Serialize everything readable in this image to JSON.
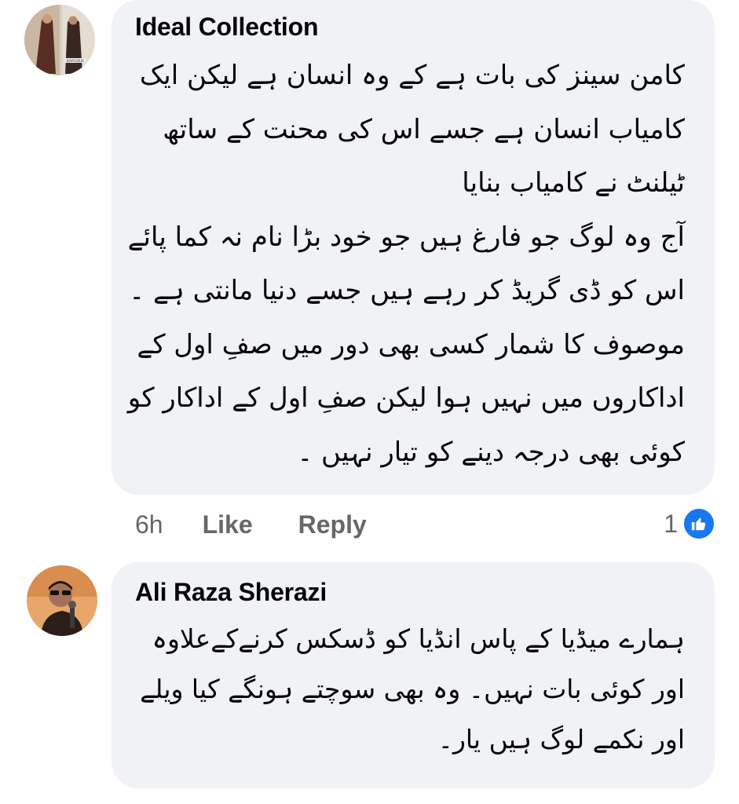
{
  "colors": {
    "bubble_bg": "#f0f2f5",
    "text": "#050505",
    "secondary_text": "#65676b",
    "like_blue": "#1877f2"
  },
  "comments": [
    {
      "author": "Ideal Collection",
      "avatar_icon": "avatar-photo",
      "avatar_text": "BAROQUE",
      "lines": [
        "کامن سینز کی بات ہے کے وہ انسان ہے لیکن ایک",
        "کامیاب انسان ہے جسے اس کی محنت کے ساتھ",
        "ٹیلنٹ نے کامیاب بنایا",
        "آج وہ لوگ جو فارغ ہیں جو خود  بڑا نام نہ کما پائے",
        "اس  کو ڈی گریڈ کر رہے ہیں جسے دنیا مانتی ہے  ۔",
        "موصوف کا شمار کسی بھی دور میں صفِ اول کے",
        "اداکاروں میں نہیں ہوا لیکن صفِ اول  کے اداکار کو",
        "کوئی  بھی درجہ دینے کو تیار نہیں ۔"
      ],
      "time": "6h",
      "like_label": "Like",
      "reply_label": "Reply",
      "reaction_count": "1",
      "reaction_icon": "thumbs-up-icon"
    },
    {
      "author": "Ali Raza Sherazi",
      "avatar_icon": "avatar-photo",
      "lines": [
        "ہمارے میڈیا کے پاس انڈیا کو ڈسکس کرنےکےعلاوہ",
        "اور کوئی بات نہیں۔ وہ بھی سوچتے ہونگے کیا ویلے",
        "اور نکمے لوگ ہیں یار۔"
      ]
    }
  ]
}
